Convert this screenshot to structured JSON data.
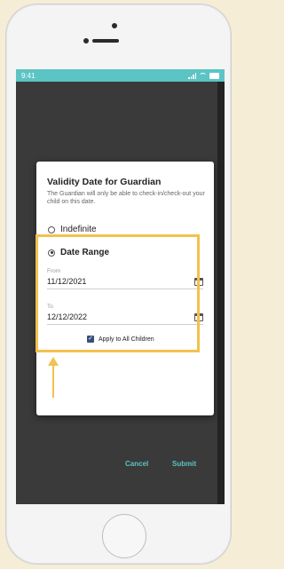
{
  "status_bar": {
    "time": "9:41"
  },
  "dialog": {
    "title": "Validity Date for Guardian",
    "subtitle": "The Guardian will only be able to check-in/check-out your child on this date.",
    "option_indefinite": "Indefinite",
    "option_date_range": "Date Range",
    "from_label": "From",
    "from_value": "11/12/2021",
    "to_label": "To",
    "to_value": "12/12/2022",
    "apply_all_label": "Apply to All Children",
    "cancel_label": "Cancel",
    "submit_label": "Submit"
  },
  "colors": {
    "accent": "#5bc3c3",
    "highlight": "#f2c14e",
    "status_bar": "#5cc4c4"
  }
}
